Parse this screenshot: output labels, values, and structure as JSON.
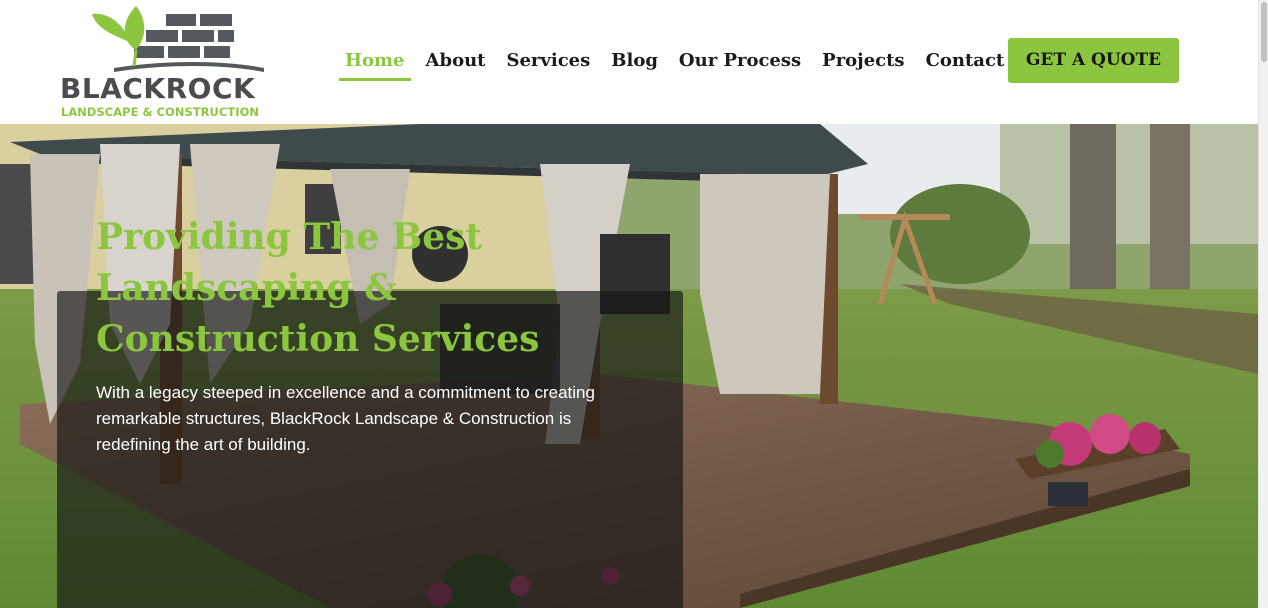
{
  "brand": {
    "name": "BLACKROCK",
    "tagline": "LANDSCAPE & CONSTRUCTION",
    "logo_icon": "leaf-and-brick-wall-icon",
    "colors": {
      "primary_green": "#8cc63f",
      "logo_gray": "#4a4c50"
    }
  },
  "nav": {
    "items": [
      {
        "label": "Home",
        "active": true
      },
      {
        "label": "About",
        "active": false
      },
      {
        "label": "Services",
        "active": false
      },
      {
        "label": "Blog",
        "active": false
      },
      {
        "label": "Our Process",
        "active": false
      },
      {
        "label": "Projects",
        "active": false
      },
      {
        "label": "Contact",
        "active": false
      }
    ],
    "cta_label": "GET A QUOTE"
  },
  "hero": {
    "title": "Providing The Best Landscaping & Construction Services",
    "text": "With a legacy steeped in excellence and a commitment to creating remarkable structures, BlackRock Landscape & Construction is redefining the art of building.",
    "background": "backyard-gazebo-photo"
  }
}
